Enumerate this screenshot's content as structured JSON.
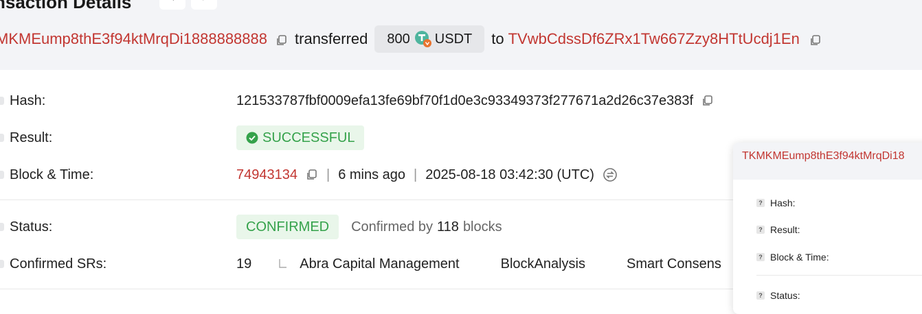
{
  "header": {
    "title": "nsaction Details",
    "prev_icon": "chevron-left-icon",
    "next_icon": "chevron-right-icon"
  },
  "transfer": {
    "from_address": "MKMEump8thE3f94ktMrqDi1888888888",
    "word_transferred": "transferred",
    "amount": "800",
    "token": "USDT",
    "token_icon": "usdt-token-icon",
    "word_to": "to",
    "to_address": "TVwbCdssDf6ZRx1Tw667Zzy8HTtUcdj1En"
  },
  "details": {
    "hash_label": "Hash:",
    "hash_value": "121533787fbf0009efa13fe69bf70f1d0e3c93349373f277671a2d26c37e383f",
    "result_label": "Result:",
    "result_value": "SUCCESSFUL",
    "block_label": "Block & Time:",
    "block_number": "74943134",
    "block_age": "6 mins ago",
    "block_time": "2025-08-18 03:42:30 (UTC)",
    "status_label": "Status:",
    "status_value": "CONFIRMED",
    "confirmed_by_prefix": "Confirmed by",
    "confirmed_by_count": "118",
    "confirmed_by_suffix": "blocks",
    "srs_label": "Confirmed SRs:",
    "srs_count": "19",
    "srs": [
      "Abra Capital Management",
      "BlockAnalysis",
      "Smart Consens"
    ]
  },
  "popup": {
    "address": "TKMKMEump8thE3f94ktMrqDi18",
    "hash_label": "Hash:",
    "result_label": "Result:",
    "block_label": "Block & Time:",
    "status_label": "Status:"
  },
  "colors": {
    "link_red": "#c23631",
    "success_green": "#35a24b",
    "success_bg": "#e9f6ea",
    "band_bg": "#f3f4f7"
  }
}
